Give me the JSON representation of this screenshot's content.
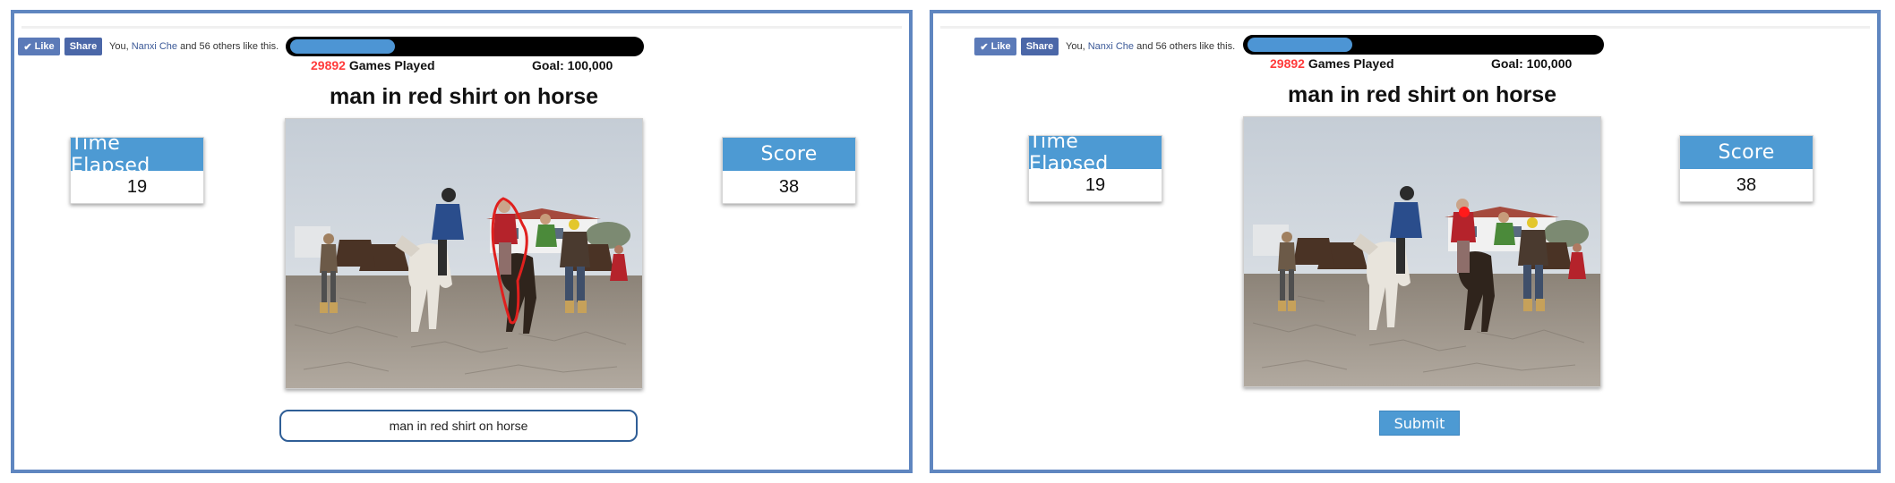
{
  "facebook": {
    "like_label": "Like",
    "share_label": "Share",
    "social_prefix": "You, ",
    "social_name": "Nanxi Che",
    "social_suffix": " and 56 others like this."
  },
  "progress": {
    "games_played": "29892",
    "games_played_label": "Games Played",
    "goal_label": "Goal: 100,000",
    "fraction": 0.29892
  },
  "caption": "man in red shirt on horse",
  "time_elapsed": {
    "label": "Time Elapsed",
    "value": "19"
  },
  "score": {
    "label": "Score",
    "value": "38"
  },
  "description_input": {
    "value": "man in red shirt on horse"
  },
  "submit_label": "Submit",
  "colors": {
    "frame": "#5f86c0",
    "accent": "#4d9ad3",
    "facebook": "#5b7ab8",
    "counter": "#ff3b3b",
    "outline": "#e0201e"
  }
}
